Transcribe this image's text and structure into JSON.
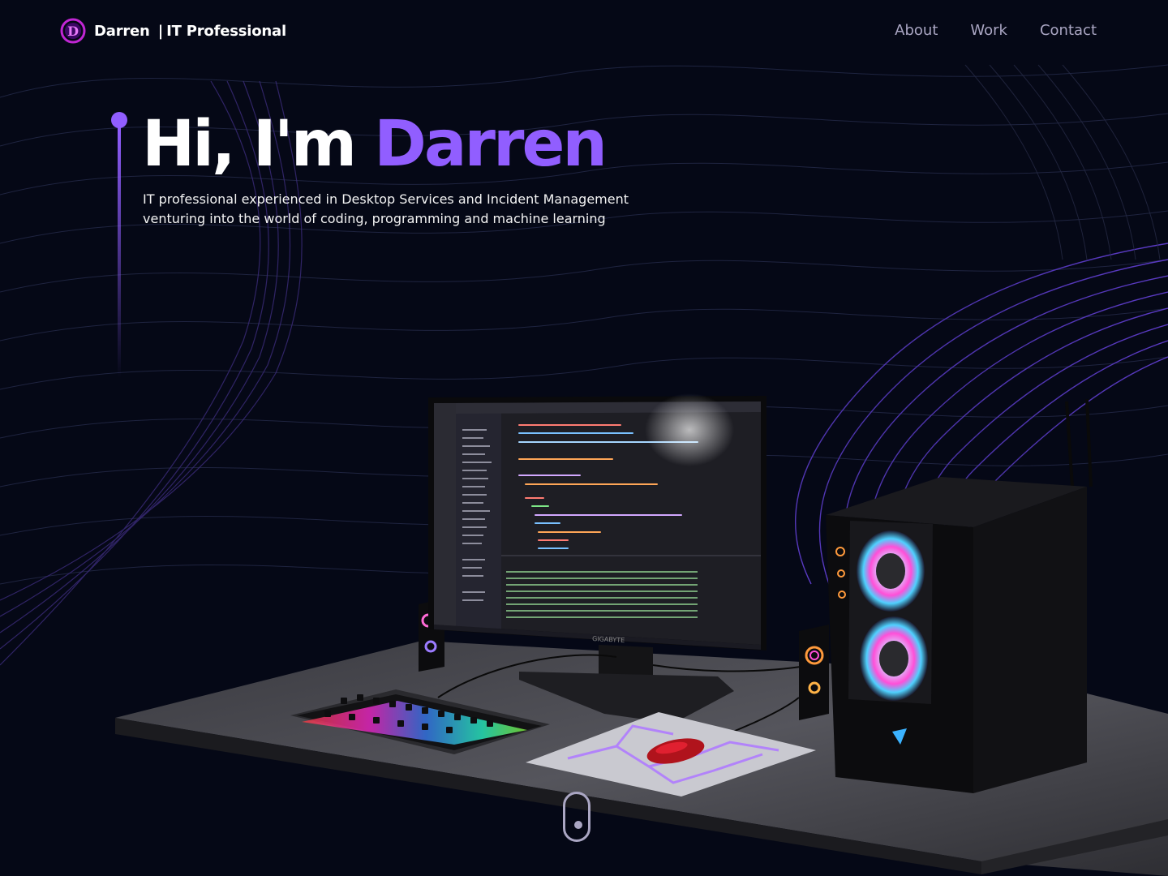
{
  "nav": {
    "logo_letter": "D",
    "brand_name": "Darren",
    "brand_separator": "|",
    "brand_role": "IT Professional",
    "links": [
      "About",
      "Work",
      "Contact"
    ]
  },
  "hero": {
    "greeting": "Hi, I'm",
    "name": "Darren",
    "subtitle_line1": "IT professional experienced in Desktop Services and Incident Management",
    "subtitle_line2": "venturing into the world of coding, programming and machine learning"
  },
  "scene": {
    "monitor_brand": "GIGABYTE"
  },
  "colors": {
    "background": "#050816",
    "accent": "#915eff",
    "secondary_text": "#aaa6c3"
  }
}
